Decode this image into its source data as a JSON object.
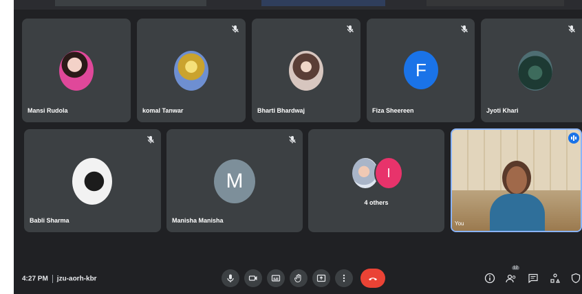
{
  "participants_row1": [
    {
      "name": "Mansi Rudola",
      "avatar_type": "photo",
      "muted": false
    },
    {
      "name": "komal Tanwar",
      "avatar_type": "photo",
      "muted": true
    },
    {
      "name": "Bharti Bhardwaj",
      "avatar_type": "photo",
      "muted": true
    },
    {
      "name": "Fiza Sheereen",
      "avatar_type": "initial",
      "initial": "F",
      "avatar_color": "#1a73e8",
      "muted": true
    },
    {
      "name": "Jyoti Khari",
      "avatar_type": "photo",
      "muted": true
    }
  ],
  "participants_row2": [
    {
      "name": "Babli Sharma",
      "avatar_type": "photo",
      "muted": true
    },
    {
      "name": "Manisha Manisha",
      "avatar_type": "initial",
      "initial": "M",
      "avatar_color": "#7d8f9a",
      "muted": true
    }
  ],
  "others_tile": {
    "label": "4 others",
    "initial": "I",
    "avatar_color": "#e8336b"
  },
  "video_tile": {
    "label": "You"
  },
  "bottom_bar": {
    "time": "4:27 PM",
    "meeting_code": "jzu-aorh-kbr",
    "people_badge": "12"
  },
  "colors": {
    "background": "#202124",
    "tile": "#3c4043",
    "end_call": "#ea4335",
    "active_border": "#8ab4f8"
  }
}
